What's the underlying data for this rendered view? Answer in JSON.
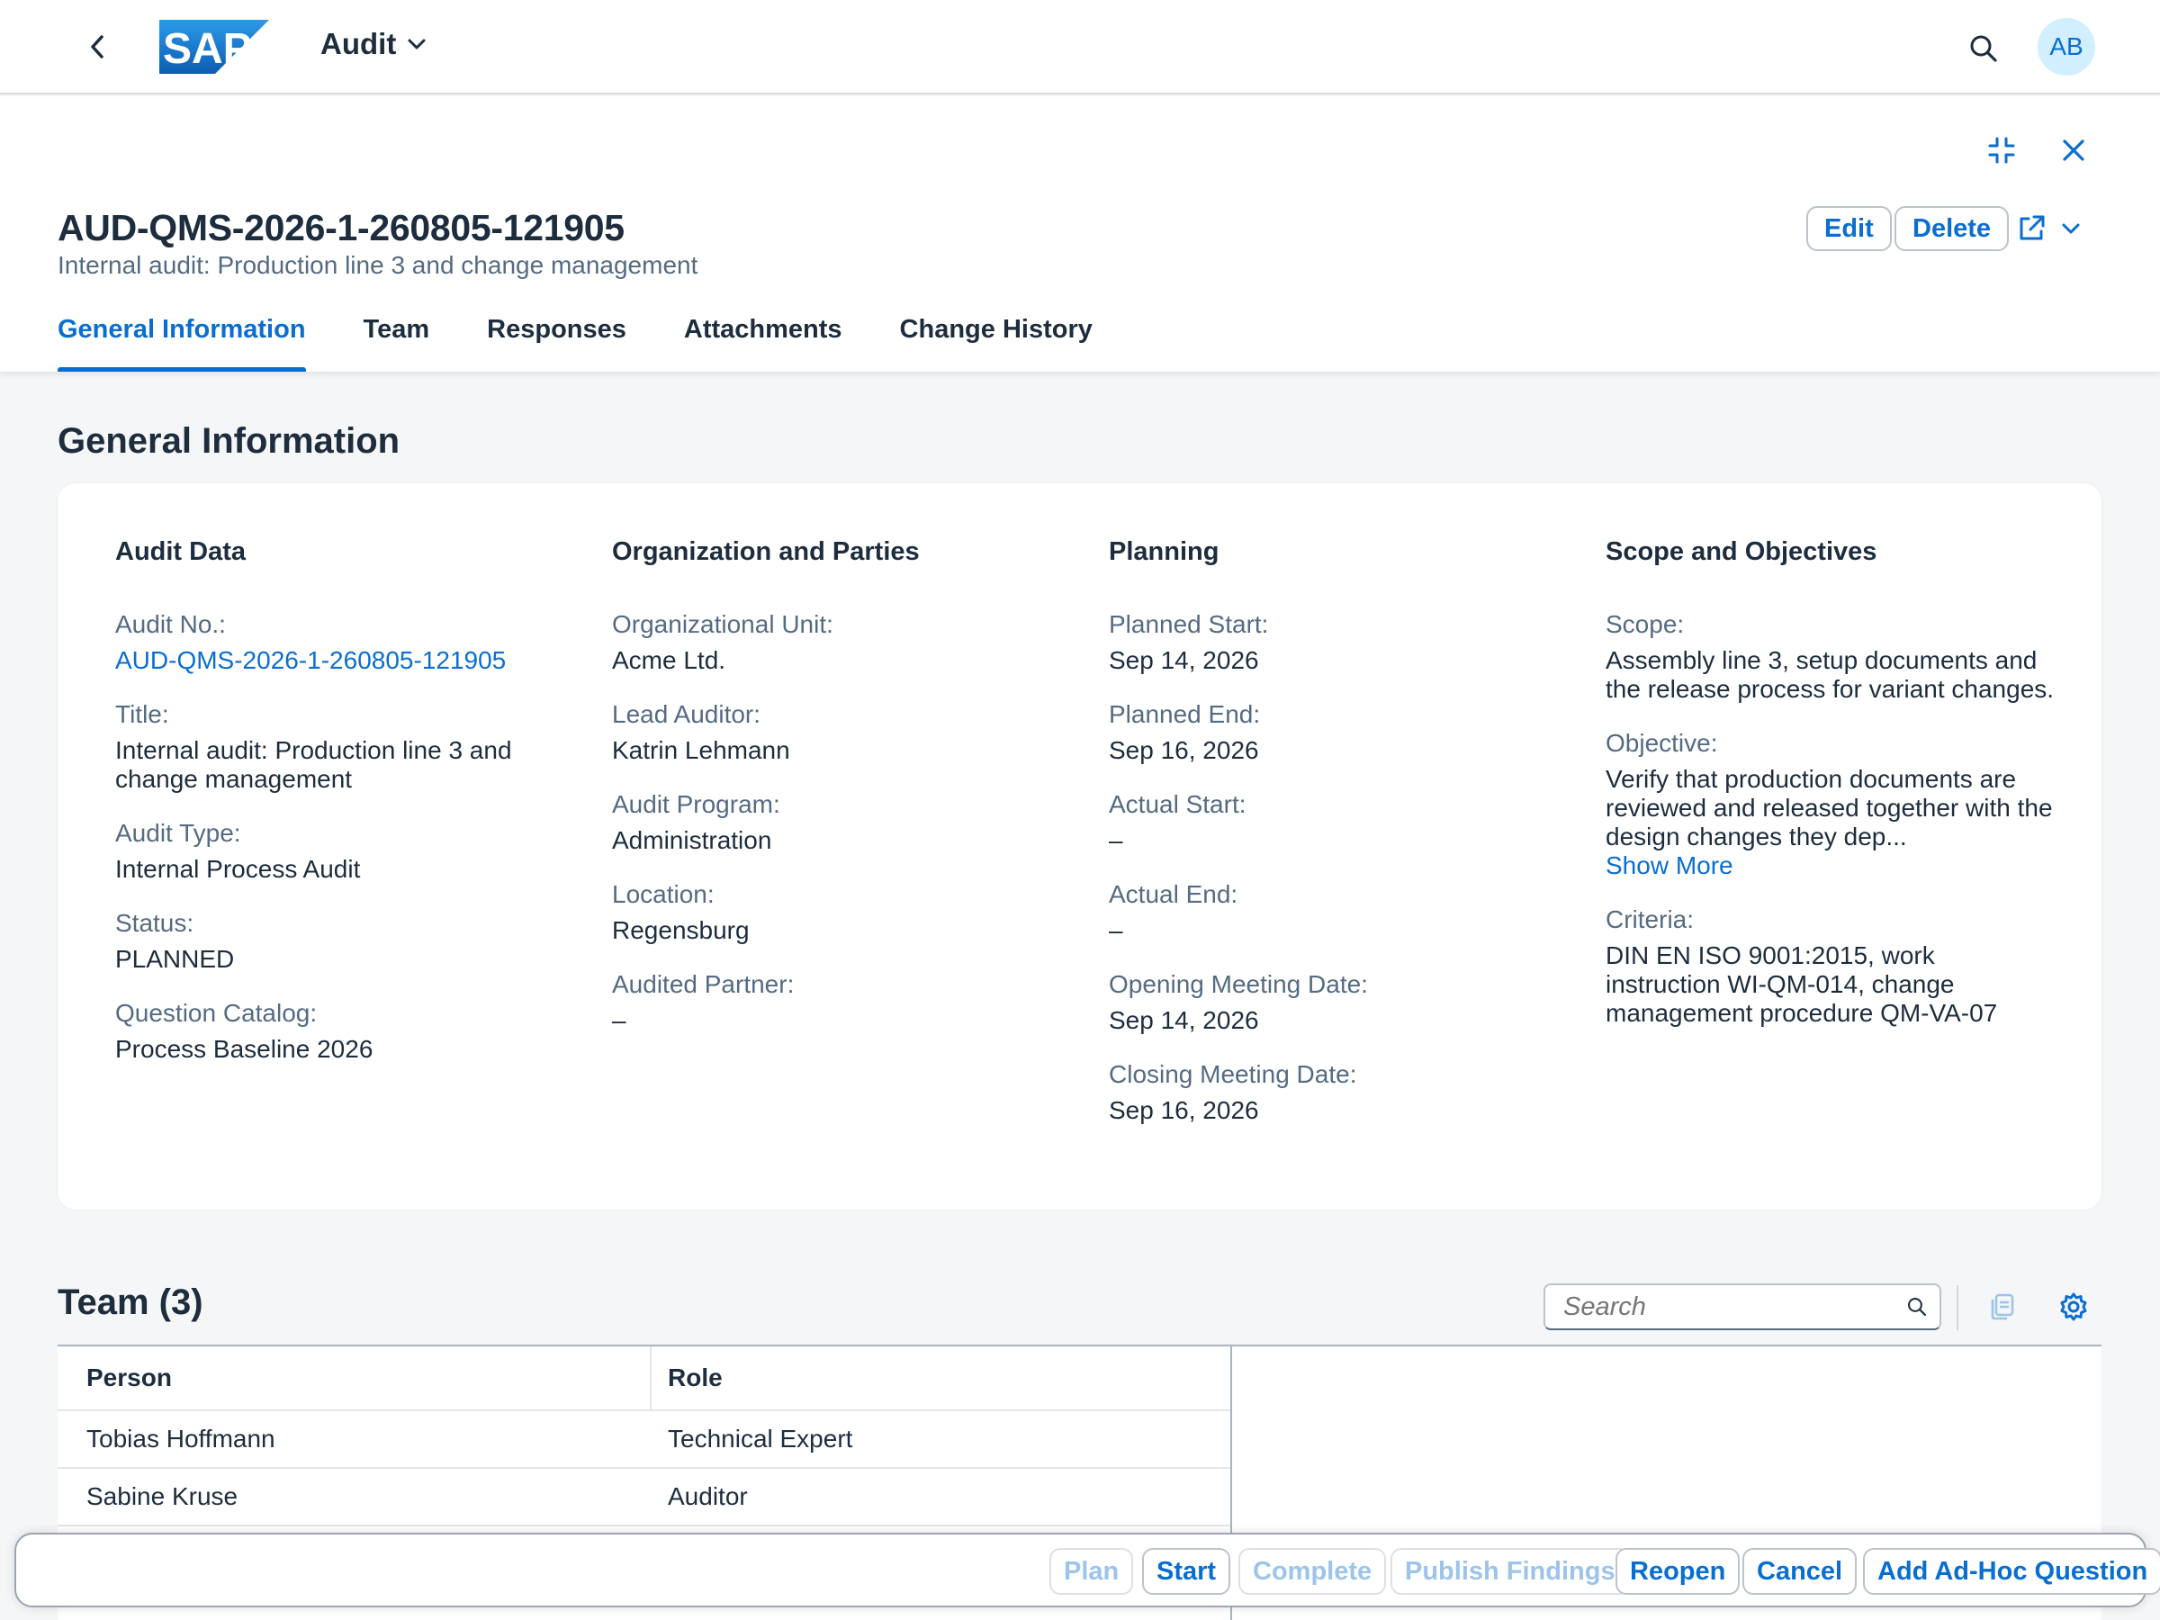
{
  "shell": {
    "logo_text": "SAP",
    "app_title": "Audit",
    "avatar_initials": "AB"
  },
  "header": {
    "title": "AUD-QMS-2026-1-260805-121905",
    "subtitle": "Internal audit: Production line 3 and change management",
    "edit_label": "Edit",
    "delete_label": "Delete"
  },
  "tabs": [
    {
      "label": "General Information",
      "active": true
    },
    {
      "label": "Team"
    },
    {
      "label": "Responses"
    },
    {
      "label": "Attachments"
    },
    {
      "label": "Change History"
    }
  ],
  "general": {
    "section_title": "General Information",
    "audit_data": {
      "heading": "Audit Data",
      "fields": [
        {
          "label": "Audit No.:",
          "value": "AUD-QMS-2026-1-260805-121905"
        },
        {
          "label": "Title:",
          "value": "Internal audit: Production line 3 and change management"
        },
        {
          "label": "Audit Type:",
          "value": "Internal Process Audit"
        },
        {
          "label": "Status:",
          "value": "PLANNED"
        },
        {
          "label": "Question Catalog:",
          "value": "Process Baseline 2026"
        }
      ]
    },
    "organization": {
      "heading": "Organization and Parties",
      "fields": [
        {
          "label": "Organizational Unit:",
          "value": "Acme Ltd."
        },
        {
          "label": "Lead Auditor:",
          "value": "Katrin Lehmann"
        },
        {
          "label": "Audit Program:",
          "value": "Administration"
        },
        {
          "label": "Location:",
          "value": "Regensburg"
        },
        {
          "label": "Audited Partner:",
          "value": "–"
        }
      ]
    },
    "planning": {
      "heading": "Planning",
      "fields": [
        {
          "label": "Planned Start:",
          "value": "Sep 14, 2026"
        },
        {
          "label": "Planned End:",
          "value": "Sep 16, 2026"
        },
        {
          "label": "Actual Start:",
          "value": "–"
        },
        {
          "label": "Actual End:",
          "value": "–"
        },
        {
          "label": "Opening Meeting Date:",
          "value": "Sep 14, 2026"
        },
        {
          "label": "Closing Meeting Date:",
          "value": "Sep 16, 2026"
        }
      ]
    },
    "scope": {
      "heading": "Scope and Objectives",
      "fields": [
        {
          "label": "Scope:",
          "value": "Assembly line 3, setup documents and the release process for variant changes."
        },
        {
          "label": "Objective:",
          "value": "Verify that production documents are reviewed and released together with the design changes they dep..."
        },
        {
          "label": "Criteria:",
          "value": "DIN EN ISO 9001:2015, work instruction WI-QM-014, change management procedure QM-VA-07"
        }
      ],
      "show_more": "Show More"
    }
  },
  "team": {
    "title": "Team (3)",
    "search_placeholder": "Search",
    "columns": [
      "Person",
      "Role"
    ],
    "rows": [
      {
        "person": "Tobias Hoffmann",
        "role": "Technical Expert"
      },
      {
        "person": "Sabine Kruse",
        "role": "Auditor"
      }
    ]
  },
  "footer": {
    "buttons": [
      {
        "label": "Plan",
        "enabled": false
      },
      {
        "label": "Start",
        "enabled": true
      },
      {
        "label": "Complete",
        "enabled": false
      },
      {
        "label": "Publish Findings",
        "enabled": false
      },
      {
        "label": "Reopen",
        "enabled": true
      },
      {
        "label": "Cancel",
        "enabled": true
      },
      {
        "label": "Add Ad-Hoc Question",
        "enabled": true
      }
    ]
  },
  "colors": {
    "brand_blue": "#0a6ed1",
    "text": "#1d2d3e",
    "label": "#556b82",
    "sap_logo_blue": "#1b75c9"
  },
  "icons": [
    "back-chevron-icon",
    "chevron-down-icon",
    "search-icon",
    "exit-fullscreen-icon",
    "close-icon",
    "share-icon",
    "copy-icon",
    "settings-gear-icon"
  ]
}
